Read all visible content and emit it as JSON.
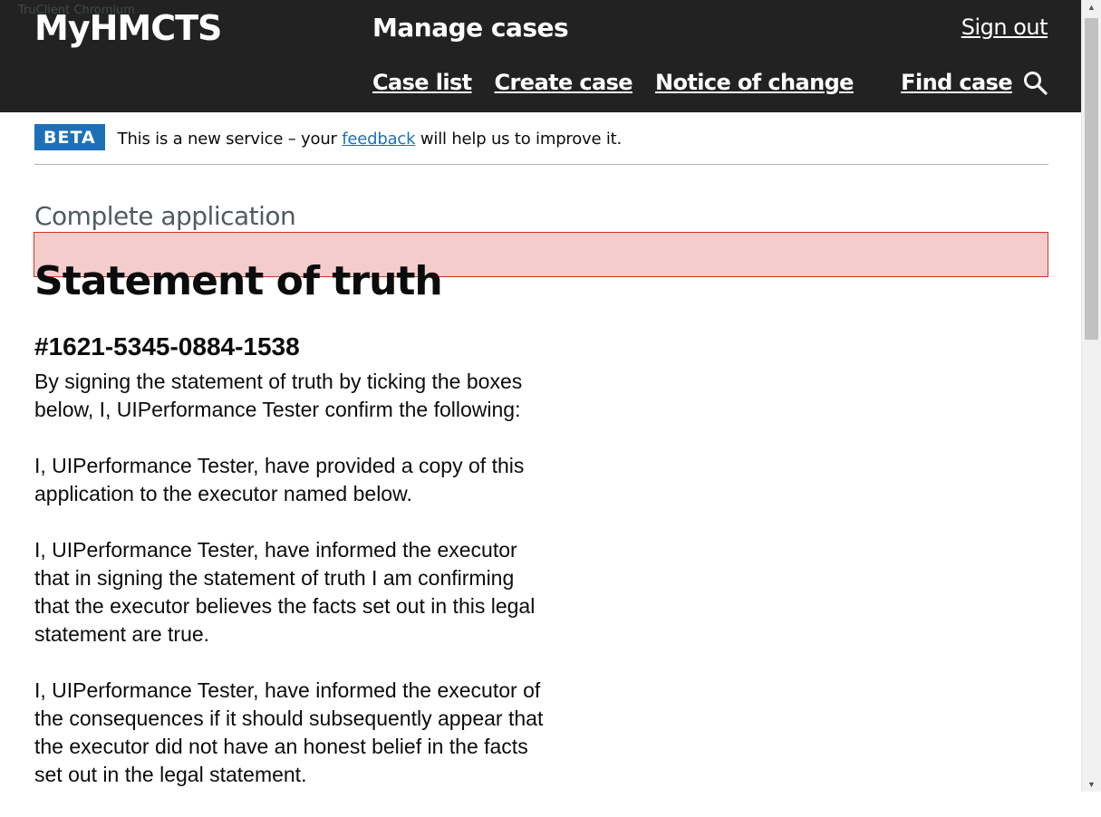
{
  "browser": {
    "title": "TruClient Chromium"
  },
  "header": {
    "logo": "MyHMCTS",
    "service_name": "Manage cases",
    "sign_out": "Sign out",
    "nav": [
      "Case list",
      "Create case",
      "Notice of change"
    ],
    "find_case": "Find case"
  },
  "beta_banner": {
    "tag": "BETA",
    "text_before": "This is a new service – your ",
    "link": "feedback",
    "text_after": " will help us to improve it."
  },
  "page": {
    "caption": "Complete application",
    "title": "Statement of truth",
    "case_reference": "#1621-5345-0884-1538",
    "paragraphs": [
      "By signing the statement of truth by ticking the boxes below, I, UIPerformance Tester confirm the following:",
      "I, UIPerformance Tester, have provided a copy of this application to the executor named below.",
      "I, UIPerformance Tester, have informed the executor that in signing the statement of truth I am confirming that the executor believes the facts set out in this legal statement are true.",
      "I, UIPerformance Tester, have informed the executor of the consequences if it should subsequently appear that the executor did not have an honest belief in the facts set out in the legal statement."
    ]
  },
  "colors": {
    "header_bg": "#222222",
    "beta_tag": "#1d70b8",
    "link": "#1d70b8",
    "heading_highlight": "#f4cccc",
    "heading_border": "#d4351c"
  },
  "icons": {
    "search": "search-icon"
  }
}
